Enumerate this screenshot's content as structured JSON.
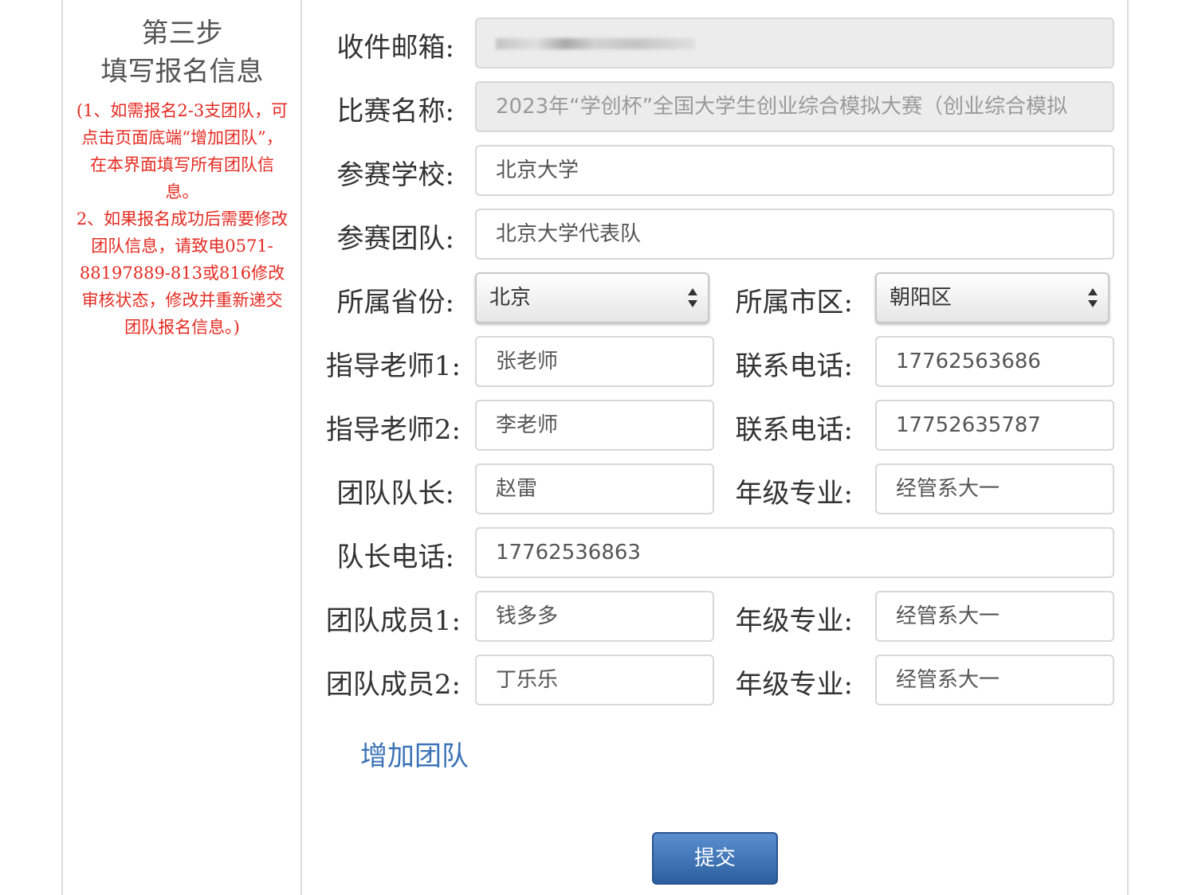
{
  "sidebar": {
    "step_title": "第三步",
    "step_subtitle": "填写报名信息",
    "note": "(1、如需报名2-3支团队，可点击页面底端“增加团队”，在本界面填写所有团队信息。\n2、如果报名成功后需要修改团队信息，请致电0571-88197889-813或816修改审核状态，修改并重新递交团队报名信息。)"
  },
  "form": {
    "email": {
      "label": "收件邮箱:",
      "value": ""
    },
    "competition": {
      "label": "比赛名称:",
      "value": "2023年“学创杯”全国大学生创业综合模拟大赛（创业综合模拟"
    },
    "school": {
      "label": "参赛学校:",
      "value": "北京大学"
    },
    "team": {
      "label": "参赛团队:",
      "value": "北京大学代表队"
    },
    "province": {
      "label": "所属省份:",
      "value": "北京"
    },
    "city": {
      "label": "所属市区:",
      "value": "朝阳区"
    },
    "teacher1": {
      "label": "指导老师1:",
      "value": "张老师"
    },
    "teacher1_phone": {
      "label": "联系电话:",
      "value": "17762563686"
    },
    "teacher2": {
      "label": "指导老师2:",
      "value": "李老师"
    },
    "teacher2_phone": {
      "label": "联系电话:",
      "value": "17752635787"
    },
    "captain": {
      "label": "团队队长:",
      "value": "赵雷"
    },
    "captain_major": {
      "label": "年级专业:",
      "value": "经管系大一"
    },
    "captain_phone": {
      "label": "队长电话:",
      "value": "17762536863"
    },
    "member1": {
      "label": "团队成员1:",
      "value": "钱多多"
    },
    "member1_major": {
      "label": "年级专业:",
      "value": "经管系大一"
    },
    "member2": {
      "label": "团队成员2:",
      "value": "丁乐乐"
    },
    "member2_major": {
      "label": "年级专业:",
      "value": "经管系大一"
    }
  },
  "actions": {
    "add_team": "增加团队",
    "submit": "提交"
  },
  "colors": {
    "note_red": "#e52b22",
    "link_blue": "#3c73b8",
    "submit_blue": "#2c5f9e"
  },
  "icons": {
    "select_arrows": "updown-arrows-icon"
  }
}
